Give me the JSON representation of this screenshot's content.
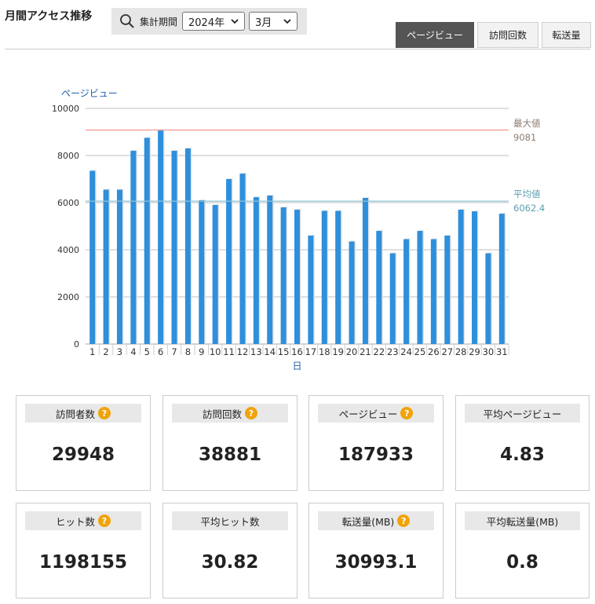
{
  "header": {
    "title": "月間アクセス推移",
    "period_label": "集計期間",
    "year_select": "2024年",
    "month_select": "3月"
  },
  "tabs": [
    {
      "label": "ページビュー",
      "active": true
    },
    {
      "label": "訪問回数",
      "active": false
    },
    {
      "label": "転送量",
      "active": false
    }
  ],
  "chart_data": {
    "type": "bar",
    "ylabel": "ページビュー",
    "xlabel": "日",
    "ylim": [
      0,
      10000
    ],
    "yticks": [
      0,
      2000,
      4000,
      6000,
      8000,
      10000
    ],
    "grid": true,
    "categories": [
      "1",
      "2",
      "3",
      "4",
      "5",
      "6",
      "7",
      "8",
      "9",
      "10",
      "11",
      "12",
      "13",
      "14",
      "15",
      "16",
      "17",
      "18",
      "19",
      "20",
      "21",
      "22",
      "23",
      "24",
      "25",
      "26",
      "27",
      "28",
      "29",
      "30",
      "31"
    ],
    "values": [
      7350,
      6550,
      6550,
      8200,
      8750,
      9081,
      8200,
      8300,
      6100,
      5900,
      7000,
      7230,
      6230,
      6300,
      5800,
      5700,
      4600,
      5650,
      5650,
      4350,
      6200,
      4800,
      3850,
      4450,
      4800,
      4450,
      4600,
      5700,
      5630,
      3850,
      5530
    ],
    "bar_color": "#2e8fdc",
    "reference_lines": [
      {
        "label": "最大値",
        "value": 9081,
        "value_text": "9081",
        "color": "#f4a09a",
        "text_color": "#8c7b6e"
      },
      {
        "label": "平均値",
        "value": 6062.4,
        "value_text": "6062.4",
        "color": "#8fc3d6",
        "text_color": "#5aa0b4"
      }
    ]
  },
  "stats": [
    {
      "label": "訪問者数",
      "value": "29948",
      "help": true
    },
    {
      "label": "訪問回数",
      "value": "38881",
      "help": true
    },
    {
      "label": "ページビュー",
      "value": "187933",
      "help": true
    },
    {
      "label": "平均ページビュー",
      "value": "4.83",
      "help": false
    },
    {
      "label": "ヒット数",
      "value": "1198155",
      "help": true
    },
    {
      "label": "平均ヒット数",
      "value": "30.82",
      "help": false
    },
    {
      "label": "転送量(MB)",
      "value": "30993.1",
      "help": true
    },
    {
      "label": "平均転送量(MB)",
      "value": "0.8",
      "help": false
    }
  ],
  "help_icon_symbol": "?",
  "colors": {
    "accent_help": "#f0a30a",
    "active_tab": "#555555"
  }
}
